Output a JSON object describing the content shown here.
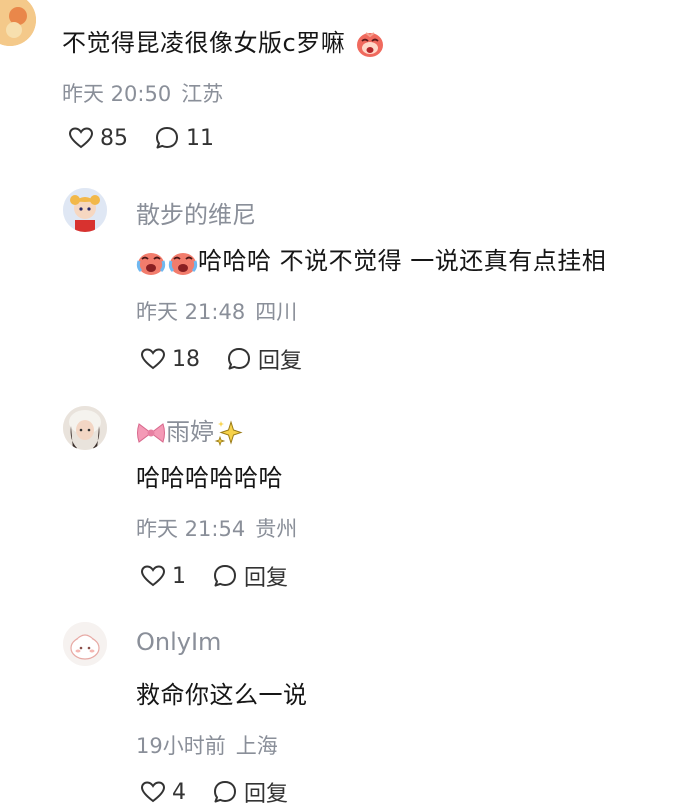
{
  "main_comment": {
    "text": "不觉得昆凌很像女版c罗嘛",
    "time": "昨天 20:50",
    "location": "江苏",
    "likes": "85",
    "replies": "11"
  },
  "replies": [
    {
      "name": "散步的维尼",
      "text": "哈哈哈 不说不觉得 一说还真有点挂相",
      "time": "昨天 21:48",
      "location": "四川",
      "likes": "18",
      "reply_label": "回复"
    },
    {
      "name": "雨婷",
      "text": "哈哈哈哈哈哈",
      "time": "昨天 21:54",
      "location": "贵州",
      "likes": "1",
      "reply_label": "回复"
    },
    {
      "name": "OnlyIm",
      "text": "救命你这么一说",
      "time": "19小时前",
      "location": "上海",
      "likes": "4",
      "reply_label": "回复"
    }
  ],
  "icons": {
    "like": "heart-outline-icon",
    "comment": "comment-bubble-icon",
    "emoji_blush": "blushing-face-emoji",
    "emoji_crying_laugh": "crying-laughing-emoji",
    "emoji_bow": "pink-bow-emoji",
    "emoji_sparkles": "sparkles-emoji"
  },
  "colors": {
    "meta_gray": "#8a8f99",
    "text": "#161616",
    "background": "#ffffff"
  }
}
